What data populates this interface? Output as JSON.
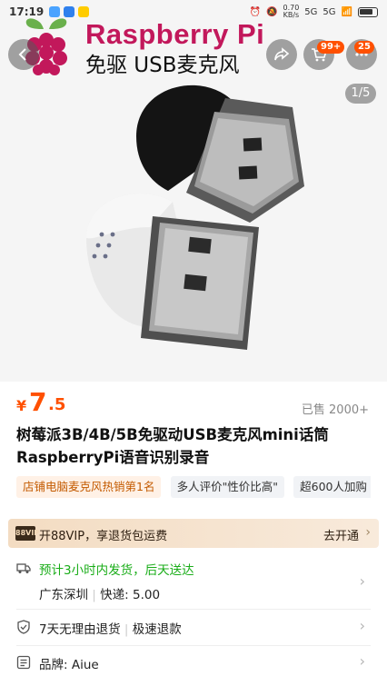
{
  "status_bar": {
    "time": "17:19",
    "speed_value": "0.70",
    "speed_unit": "KB/s",
    "network_1": "5G",
    "network_2": "5G",
    "battery": "battery"
  },
  "hero": {
    "brand_title": "Raspberry Pi",
    "brand_subtitle": "免驱 USB麦克风",
    "image_counter": "1/5",
    "cart_badge": "99+",
    "more_badge": "25"
  },
  "price": {
    "symbol": "¥",
    "integer": "7",
    "decimal": ".5",
    "sold": "已售 2000+"
  },
  "product_title": "树莓派3B/4B/5B免驱动USB麦克风mini话筒RaspberryPi语音识别录音",
  "tags": [
    {
      "label": "店铺电脑麦克风热销第1名"
    },
    {
      "label": "多人评价\"性价比高\""
    },
    {
      "label": "超600人加购"
    }
  ],
  "vip": {
    "logo": "88VIP",
    "text": "开88VIP，享退货包运费",
    "action": "去开通"
  },
  "shipping": {
    "promise": "预计3小时内发货，后天送达",
    "origin": "广东深圳",
    "separator": "|",
    "fee": "快递:  5.00"
  },
  "returns": {
    "text": "7天无理由退货",
    "separator": "|",
    "text2": "极速退款"
  },
  "brand_row": {
    "text": "品牌: Aiue"
  },
  "colors": {
    "accent": "#ff5000",
    "green": "#1aad19",
    "brand_pink": "#c2185b"
  }
}
